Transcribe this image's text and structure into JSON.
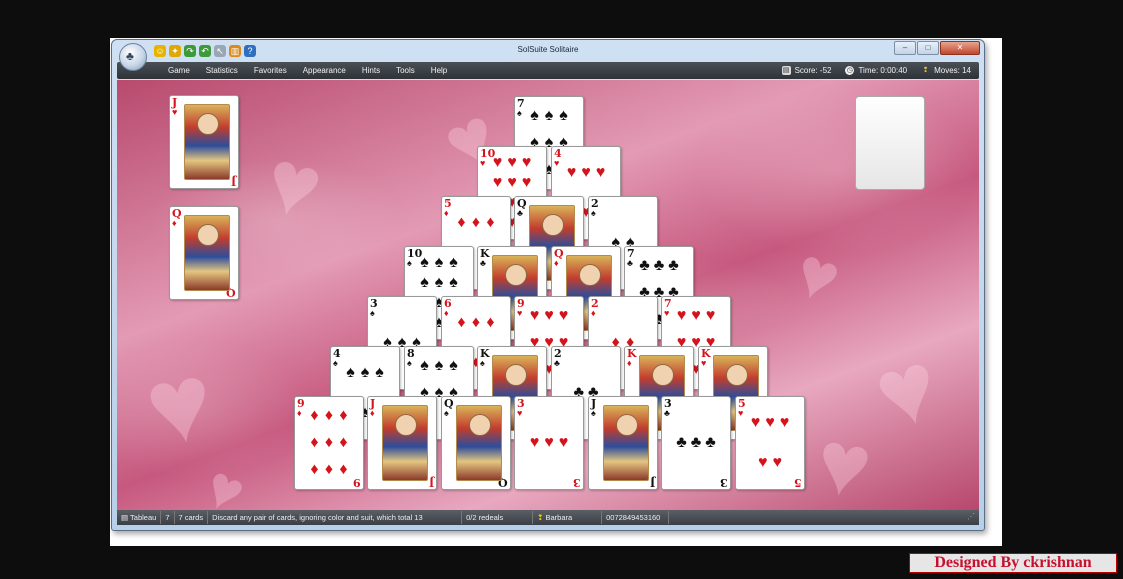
{
  "window": {
    "title": "SolSuite Solitaire"
  },
  "quick_access": [
    {
      "icon": "smiley-icon",
      "color": "#e6b400",
      "glyph": "☺"
    },
    {
      "icon": "bulb-icon",
      "color": "#e0a800",
      "glyph": "✦"
    },
    {
      "icon": "redo-icon",
      "color": "#3d9a38",
      "glyph": "↷"
    },
    {
      "icon": "undo-icon",
      "color": "#3d9a38",
      "glyph": "↶"
    },
    {
      "icon": "pointer-icon",
      "color": "#9aa6b4",
      "glyph": "↖"
    },
    {
      "icon": "bar-chart-icon",
      "color": "#d98a1a",
      "glyph": "▥"
    },
    {
      "icon": "help-icon",
      "color": "#2f6fbe",
      "glyph": "?"
    }
  ],
  "window_buttons": {
    "minimize": "–",
    "maximize": "□",
    "close": "✕"
  },
  "menu": [
    "Game",
    "Statistics",
    "Favorites",
    "Appearance",
    "Hints",
    "Tools",
    "Help"
  ],
  "stats": {
    "score": "Score: -52",
    "time": "Time: 0:00:40",
    "moves": "Moves: 14"
  },
  "side_cards": [
    {
      "rank": "J",
      "suit": "♥",
      "color": "red",
      "face": true
    },
    {
      "rank": "Q",
      "suit": "♦",
      "color": "red",
      "face": true
    }
  ],
  "pyramid": [
    [
      {
        "rank": "7",
        "suit": "♠",
        "color": "black"
      }
    ],
    [
      {
        "rank": "10",
        "suit": "♥",
        "color": "red"
      },
      {
        "rank": "4",
        "suit": "♥",
        "color": "red"
      }
    ],
    [
      {
        "rank": "5",
        "suit": "♦",
        "color": "red"
      },
      {
        "rank": "Q",
        "suit": "♣",
        "color": "black",
        "face": true
      },
      {
        "rank": "2",
        "suit": "♠",
        "color": "black"
      }
    ],
    [
      {
        "rank": "10",
        "suit": "♠",
        "color": "black"
      },
      {
        "rank": "K",
        "suit": "♣",
        "color": "black",
        "face": true
      },
      {
        "rank": "Q",
        "suit": "♦",
        "color": "red",
        "face": true
      },
      {
        "rank": "7",
        "suit": "♣",
        "color": "black"
      }
    ],
    [
      {
        "rank": "3",
        "suit": "♠",
        "color": "black"
      },
      {
        "rank": "6",
        "suit": "♦",
        "color": "red"
      },
      {
        "rank": "9",
        "suit": "♥",
        "color": "red"
      },
      {
        "rank": "2",
        "suit": "♦",
        "color": "red"
      },
      {
        "rank": "7",
        "suit": "♥",
        "color": "red"
      }
    ],
    [
      {
        "rank": "4",
        "suit": "♠",
        "color": "black"
      },
      {
        "rank": "8",
        "suit": "♠",
        "color": "black"
      },
      {
        "rank": "K",
        "suit": "♠",
        "color": "black",
        "face": true
      },
      {
        "rank": "2",
        "suit": "♣",
        "color": "black"
      },
      {
        "rank": "K",
        "suit": "♦",
        "color": "red",
        "face": true
      },
      {
        "rank": "K",
        "suit": "♥",
        "color": "red",
        "face": true
      }
    ],
    [
      {
        "rank": "9",
        "suit": "♦",
        "color": "red"
      },
      {
        "rank": "J",
        "suit": "♦",
        "color": "red",
        "face": true
      },
      {
        "rank": "Q",
        "suit": "♠",
        "color": "black",
        "face": true
      },
      {
        "rank": "3",
        "suit": "♥",
        "color": "red"
      },
      {
        "rank": "J",
        "suit": "♠",
        "color": "black",
        "face": true
      },
      {
        "rank": "3",
        "suit": "♣",
        "color": "black"
      },
      {
        "rank": "5",
        "suit": "♥",
        "color": "red"
      }
    ]
  ],
  "statusbar": {
    "game": "Tableau",
    "count": "7",
    "cards": "7 cards",
    "hint": "Discard any pair of cards, ignoring color and suit, which total 13",
    "redeals": "0/2 redeals",
    "player": "Barbara",
    "seed": "0072849453160"
  },
  "credit": "Designed By ckrishnan",
  "colors": {
    "red_suit": "#d4141c",
    "black_suit": "#111111",
    "menubar": "#3a3f45"
  }
}
